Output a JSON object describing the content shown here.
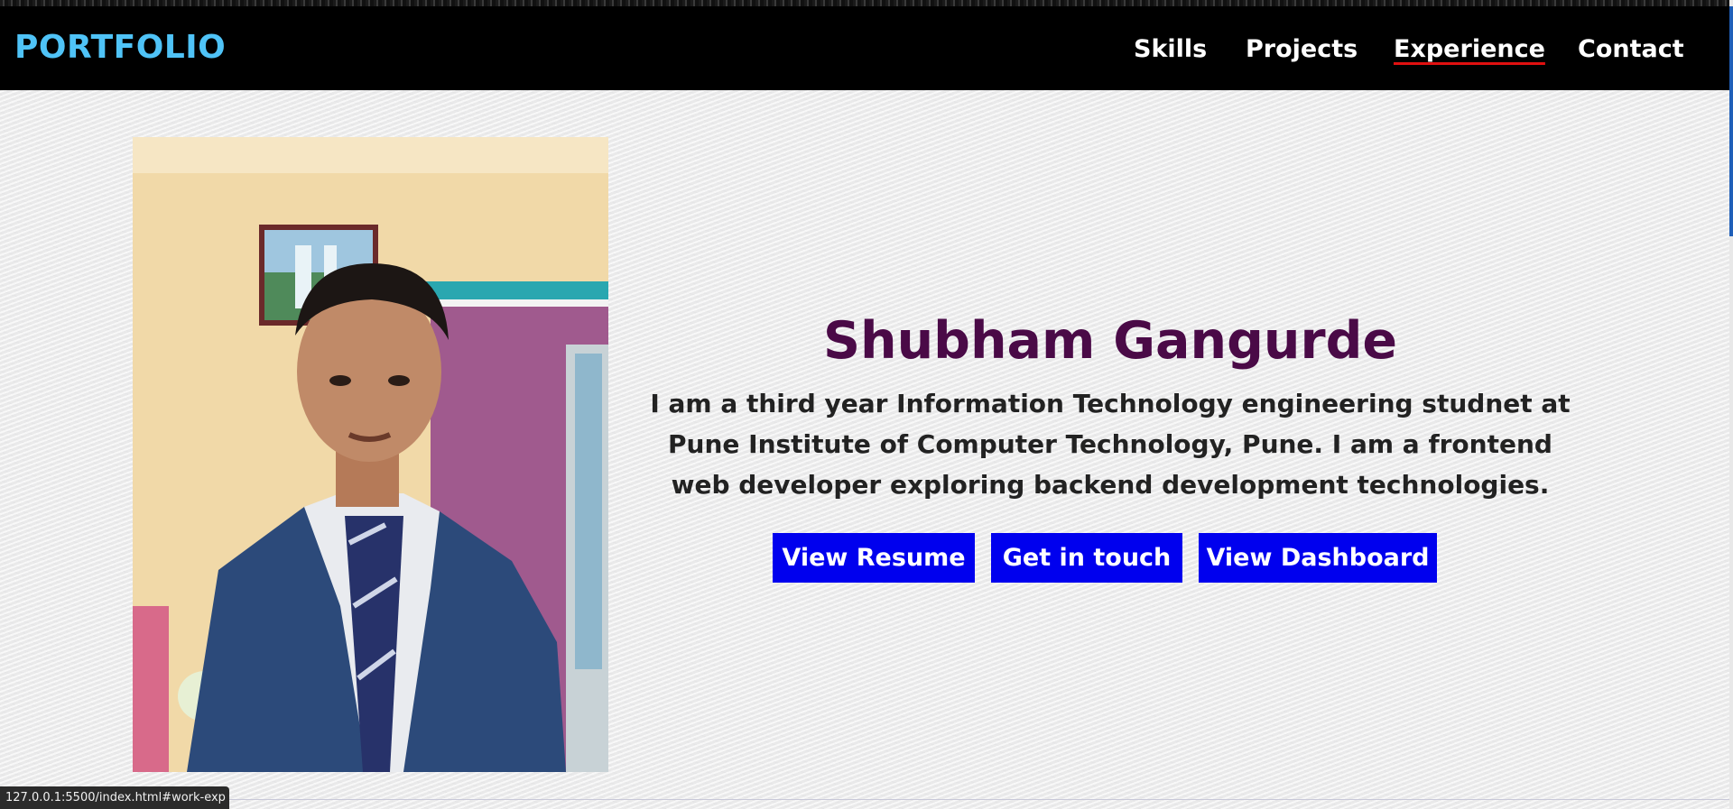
{
  "nav": {
    "brand": "PORTFOLIO",
    "links": [
      "Skills",
      "Projects",
      "Experience",
      "Contact"
    ],
    "active": "Experience",
    "active_underline_color": "#e01010"
  },
  "hero": {
    "name": "Shubham Gangurde",
    "bio": "I am a third year Information Technology engineering studnet at Pune Institute of Computer Technology, Pune. I am a frontend web developer exploring backend development technologies.",
    "buttons": [
      "View Resume",
      "Get in touch",
      "View Dashboard"
    ],
    "photo_icon": "profile-photo"
  },
  "status_bar": {
    "url": "127.0.0.1:5500/index.html#work-exp"
  },
  "colors": {
    "brand": "#4fc3f7",
    "name": "#4a0a47",
    "button": "#0000ee",
    "navbar": "#000000"
  }
}
